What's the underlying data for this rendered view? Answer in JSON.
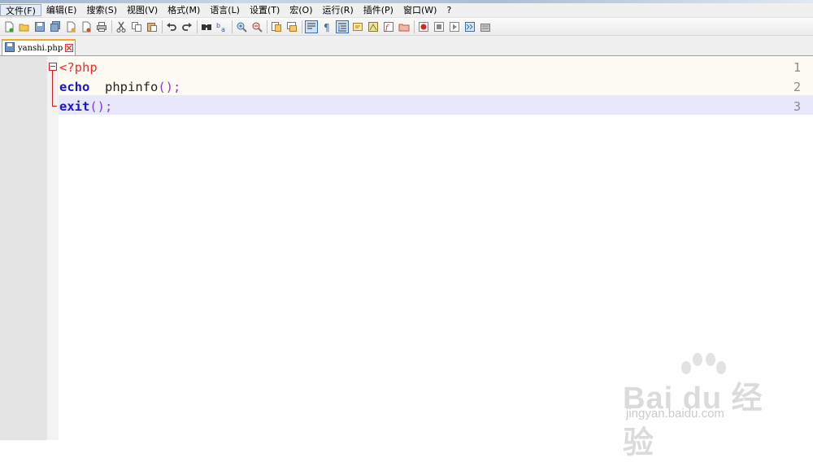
{
  "menu": {
    "items": [
      "文件(F)",
      "编辑(E)",
      "搜索(S)",
      "视图(V)",
      "格式(M)",
      "语言(L)",
      "设置(T)",
      "宏(O)",
      "运行(R)",
      "插件(P)",
      "窗口(W)",
      "?"
    ]
  },
  "toolbar": {
    "icons": [
      "new-file-icon",
      "open-file-icon",
      "save-icon",
      "save-all-icon",
      "close-icon",
      "close-all-icon",
      "print-icon",
      "cut-icon",
      "copy-icon",
      "paste-icon",
      "undo-icon",
      "redo-icon",
      "find-icon",
      "replace-icon",
      "zoom-in-icon",
      "zoom-out-icon",
      "sync-vertical-icon",
      "sync-horizontal-icon",
      "word-wrap-icon",
      "show-all-chars-icon",
      "indent-guide-icon",
      "user-language-icon",
      "doc-map-icon",
      "function-list-icon",
      "folder-as-workspace-icon",
      "record-macro-icon",
      "stop-record-icon",
      "play-macro-icon",
      "run-macro-multiple-icon",
      "save-macro-icon"
    ]
  },
  "tab": {
    "filename": "yanshi.php"
  },
  "editor": {
    "line_numbers": [
      "1",
      "2",
      "3"
    ],
    "line1": {
      "php_open": "<?php"
    },
    "line2": {
      "keyword": "echo",
      "func": "  phpinfo",
      "parens": "();"
    },
    "line3": {
      "keyword": "exit",
      "parens": "();"
    }
  },
  "watermark": {
    "brand": "Bai du 经验",
    "url": "jingyan.baidu.com"
  },
  "colors": {
    "php_tag": "#ee2b2b",
    "keyword": "#1b15c9",
    "parens": "#8a3dd0",
    "current_line": "#e7e8fb",
    "tab_accent": "#f6a623"
  }
}
